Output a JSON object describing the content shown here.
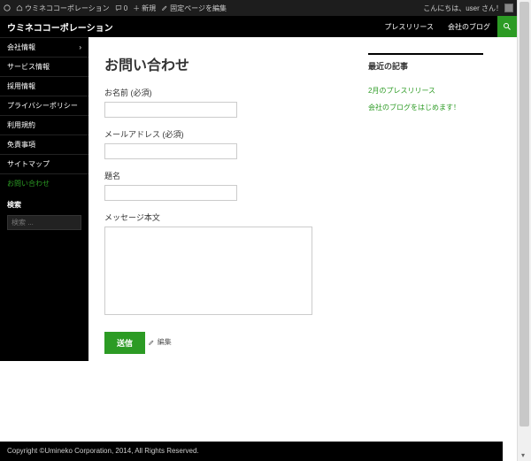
{
  "adminbar": {
    "site_name": "ウミネココーポレーション",
    "comments": "0",
    "new": "新規",
    "edit_page": "固定ページを編集",
    "greeting": "こんにちは、user さん！"
  },
  "header": {
    "title": "ウミネココーポレーション",
    "nav": {
      "press": "プレスリリース",
      "blog": "会社のブログ"
    }
  },
  "sidebar": {
    "items": [
      {
        "label": "会社情報"
      },
      {
        "label": "サービス情報"
      },
      {
        "label": "採用情報"
      },
      {
        "label": "プライバシーポリシー"
      },
      {
        "label": "利用規約"
      },
      {
        "label": "免責事項"
      },
      {
        "label": "サイトマップ"
      },
      {
        "label": "お問い合わせ"
      }
    ],
    "search_title": "検索",
    "search_placeholder": "検索 ..."
  },
  "page": {
    "title": "お問い合わせ",
    "fields": {
      "name_label": "お名前 (必須)",
      "email_label": "メールアドレス (必須)",
      "subject_label": "題名",
      "message_label": "メッセージ本文"
    },
    "submit": "送信",
    "edit": "編集"
  },
  "aside": {
    "recent_title": "最近の記事",
    "posts": [
      {
        "title": "2月のプレスリリース"
      },
      {
        "title": "会社のブログをはじめます！"
      }
    ]
  },
  "footer": {
    "text": "Copyright ©Umineko Corporation, 2014, All Rights Reserved."
  }
}
